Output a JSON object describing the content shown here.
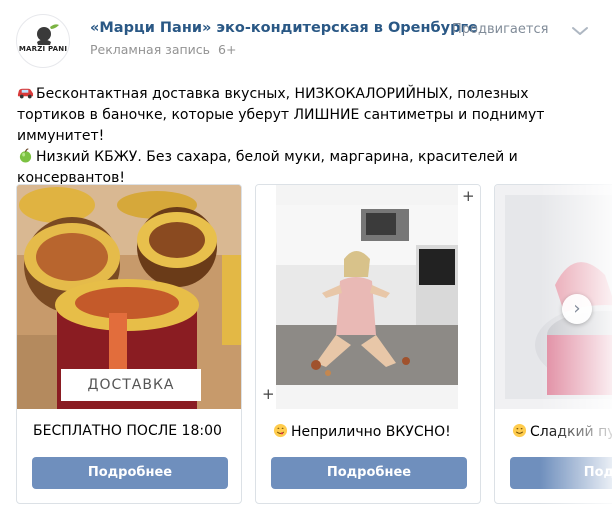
{
  "header": {
    "group_name": "«Марци Пани» эко-кондитерская в Оренбурге",
    "ad_label": "Рекламная запись",
    "age_rating": "6+",
    "promoted_label": "Продвигается",
    "avatar_logo_text": "MARZI PANI"
  },
  "post": {
    "line1": "Бесконтактная доставка вкусных, НИЗКОКАЛОРИЙНЫХ, полезных тортиков в баночке, которые уберут ЛИШНИЕ сантиметры и поднимут иммунитет!",
    "line2": "Низкий КБЖУ. Без сахара, белой муки, маргарина, красителей и консервантов!",
    "line1_emoji": "red-car-emoji",
    "line2_emoji": "green-apple-emoji"
  },
  "cards": [
    {
      "title": "БЕСПЛАТНО ПОСЛЕ 18:00",
      "button": "Подробнее",
      "overlay_text": "ДОСТАВКА",
      "title_emoji": ""
    },
    {
      "title": "Неприлично ВКУСНО!",
      "button": "Подробнее",
      "title_emoji": "yum-face-emoji"
    },
    {
      "title": "Сладкий пут",
      "button": "Подро",
      "title_emoji": "smile-face-emoji"
    }
  ],
  "colors": {
    "link": "#2a5885",
    "muted": "#939393",
    "button": "#6f8fbd",
    "border": "#dce1e6"
  }
}
